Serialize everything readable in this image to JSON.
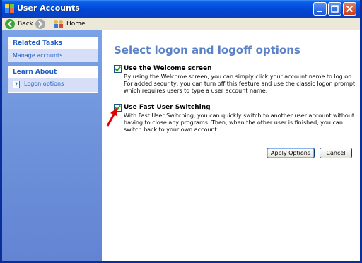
{
  "window": {
    "title": "User Accounts"
  },
  "toolbar": {
    "back_label": "Back",
    "home_label": "Home"
  },
  "sidebar": {
    "related_tasks": {
      "header": "Related Tasks",
      "items": [
        "Manage accounts"
      ]
    },
    "learn_about": {
      "header": "Learn About",
      "items": [
        "Logon options"
      ]
    }
  },
  "main": {
    "title": "Select logon and logoff options",
    "welcome": {
      "label_pre": "Use the ",
      "label_ul": "W",
      "label_post": "elcome screen",
      "checked": true,
      "description": "By using the Welcome screen, you can simply click your account name to log on. For added security, you can turn off this feature and use the classic logon prompt which requires users to type a user account name."
    },
    "fast_switching": {
      "label_pre": "Use ",
      "label_ul": "F",
      "label_post": "ast User Switching",
      "checked": true,
      "description": "With Fast User Switching, you can quickly switch to another user account without having to close any programs. Then, when the other user is finished, you can switch back to your own account."
    },
    "apply_label_pre": "",
    "apply_label_ul": "A",
    "apply_label_post": "pply Options",
    "cancel_label": "Cancel"
  },
  "colors": {
    "title_blue": "#0047d6",
    "sidebar_blue": "#6b8fd8",
    "heading_blue": "#5b81c7",
    "link_blue": "#215dc6",
    "arrow_red": "#e10000"
  }
}
